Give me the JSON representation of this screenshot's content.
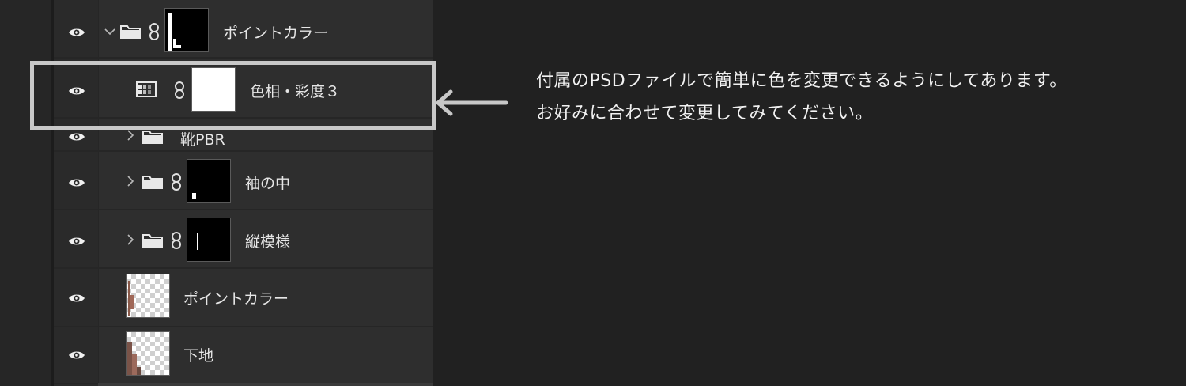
{
  "layers_panel": {
    "rows": [
      {
        "name": "ポイントカラー",
        "kind": "group",
        "expanded": true,
        "has_mask": true
      },
      {
        "name": "色相・彩度３",
        "kind": "adjustment",
        "has_mask": true
      },
      {
        "name": "靴PBR",
        "kind": "group",
        "expanded": false,
        "has_mask": false
      },
      {
        "name": "袖の中",
        "kind": "group",
        "expanded": false,
        "has_mask": true
      },
      {
        "name": "縦模様",
        "kind": "group",
        "expanded": false,
        "has_mask": true
      },
      {
        "name": "ポイントカラー",
        "kind": "layer"
      },
      {
        "name": "下地",
        "kind": "layer"
      }
    ]
  },
  "annotation": {
    "line1": "付属のPSDファイルで簡単に色を変更できるようにしてあります。",
    "line2": "お好みに合わせて変更してみてください。"
  },
  "colors": {
    "background": "#212121",
    "panel": "#2e2e2e",
    "highlight_border": "#c8c8c8",
    "text": "#f2f2f2"
  },
  "icons": {
    "visibility": "eye-icon",
    "folder": "folder-icon",
    "link": "chain-link-icon",
    "adjustment": "hue-saturation-adjustment-icon",
    "arrow": "left-arrow-icon"
  }
}
